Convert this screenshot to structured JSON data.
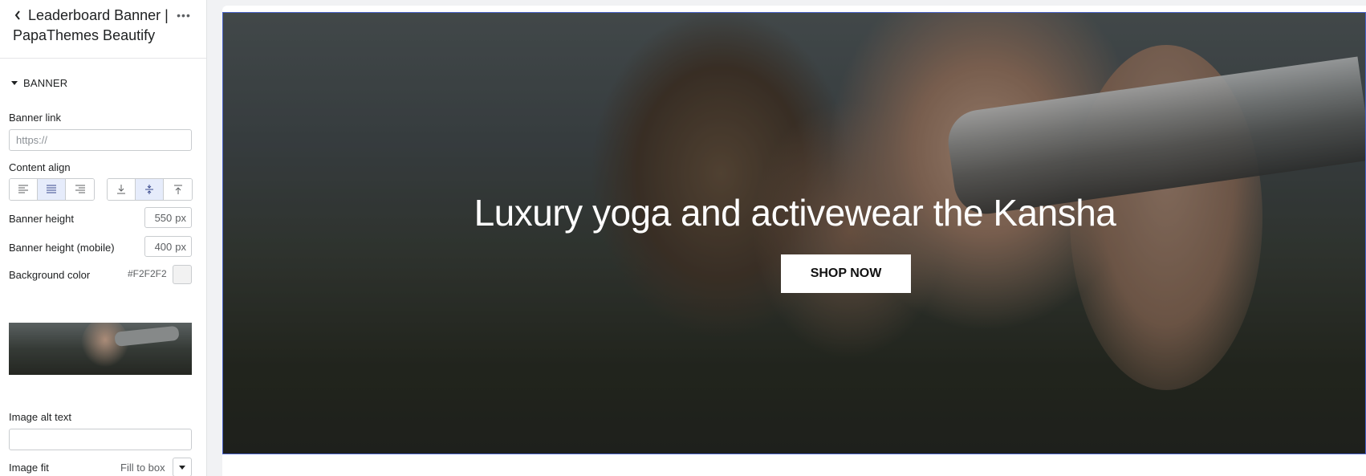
{
  "sidebar": {
    "title": "Leaderboard Banner | PapaThemes Beautify",
    "section_label": "BANNER",
    "banner_link": {
      "label": "Banner link",
      "placeholder": "https://",
      "value": ""
    },
    "content_align": {
      "label": "Content align",
      "horizontal_selected": "center",
      "vertical_selected": "middle"
    },
    "banner_height": {
      "label": "Banner height",
      "value": "550",
      "unit": "px"
    },
    "banner_height_mobile": {
      "label": "Banner height (mobile)",
      "value": "400",
      "unit": "px"
    },
    "background_color": {
      "label": "Background color",
      "value": "#F2F2F2",
      "swatch": "#F2F2F2"
    },
    "image_alt_text": {
      "label": "Image alt text",
      "value": ""
    },
    "image_fit": {
      "label": "Image fit",
      "value": "Fill to box"
    }
  },
  "banner": {
    "headline": "Luxury yoga and activewear the Kansha",
    "button_label": "SHOP NOW",
    "selection_outline_color": "#4a63c8"
  }
}
